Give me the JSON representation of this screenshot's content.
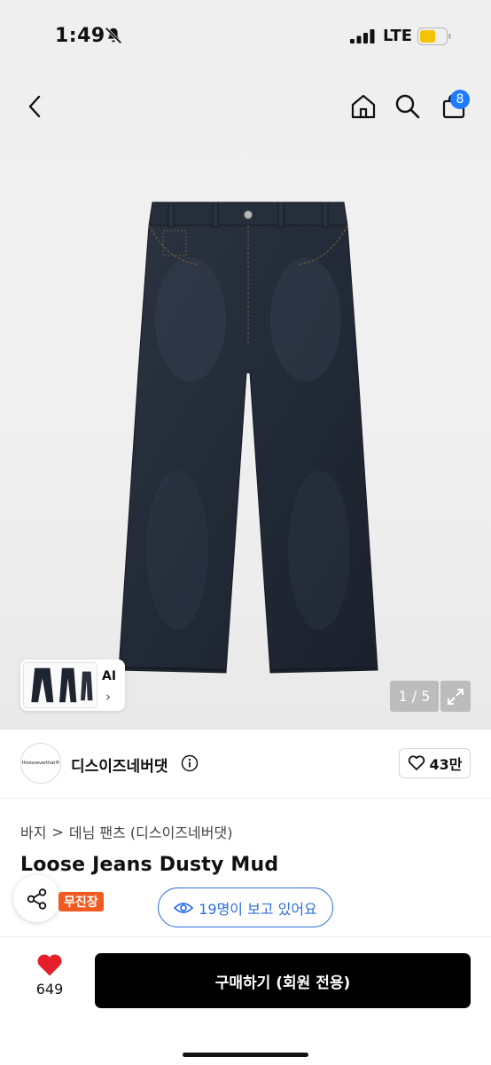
{
  "status": {
    "time": "1:49",
    "network": "LTE",
    "battery_color": "#f5c400"
  },
  "nav": {
    "cart_count": "8",
    "accent": "#1e7bff"
  },
  "gallery": {
    "counter": "1 / 5",
    "ai_label": "AI",
    "ai_chevron": "›",
    "background": "#efefef"
  },
  "brand": {
    "logo_text": "thisisneverthat®",
    "name": "디스이즈네버댓",
    "likes": "43만"
  },
  "product": {
    "breadcrumb": [
      "바지",
      "데님 팬츠 (디스이즈네버댓)"
    ],
    "breadcrumb_sep": ">",
    "title": "Loose Jeans Dusty Mud",
    "badge": "무진장",
    "badge_color": "#f15a22",
    "viewers": "19명이 보고 있어요",
    "viewers_color": "#2f6fdc"
  },
  "bottom": {
    "wish_count": "649",
    "buy_label": "구매하기 (회원 전용)",
    "heart_color": "#e5202a"
  }
}
